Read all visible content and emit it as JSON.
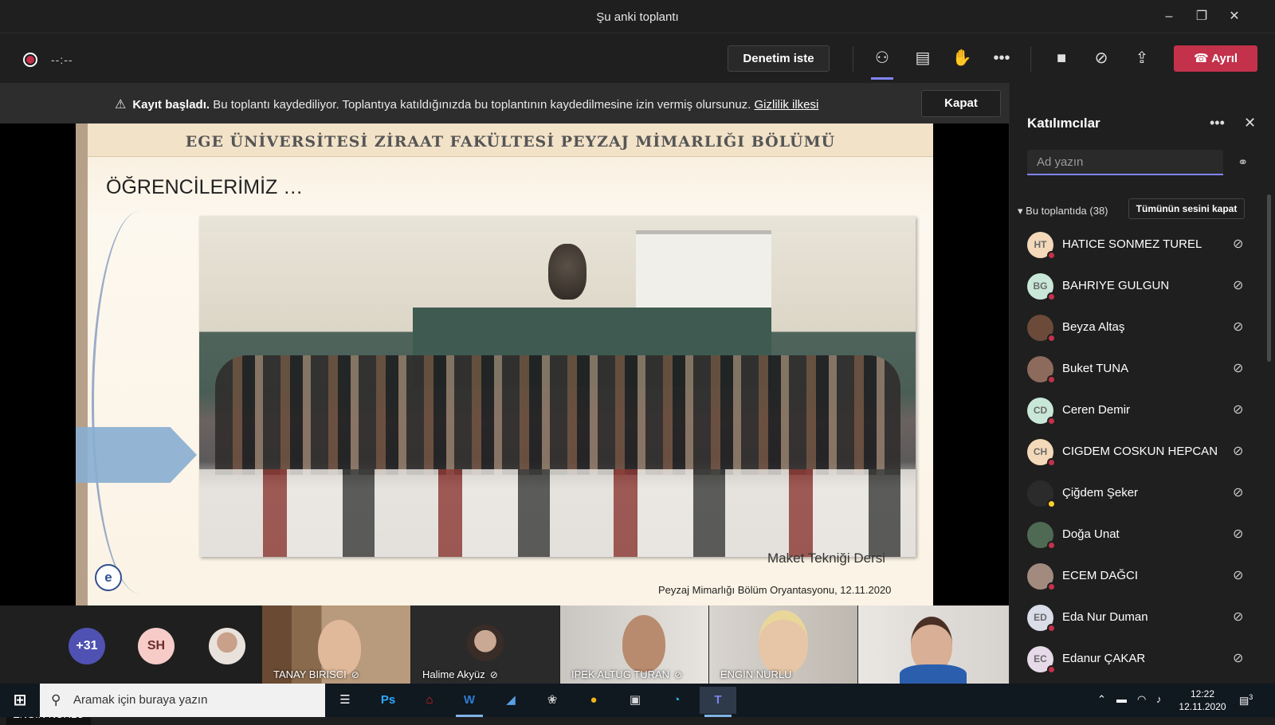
{
  "window": {
    "title": "Şu anki toplantı"
  },
  "toolbar": {
    "timer": "--:--",
    "control_label": "Denetim iste",
    "leave_label": "Ayrıl",
    "icons": [
      "participants-icon",
      "chat-icon",
      "raise-hand-icon",
      "more-options-icon",
      "camera-icon",
      "mic-muted-icon",
      "share-screen-icon"
    ]
  },
  "banner": {
    "bold": "Kayıt başladı.",
    "text": " Bu toplantı kaydediliyor. Toplantıya katıldığınızda bu toplantının kaydedilmesine izin vermiş olursunuz. ",
    "link": "Gizlilik ilkesi",
    "close_label": "Kapat"
  },
  "slide": {
    "header": "EGE ÜNİVERSİTESİ ZİRAAT FAKÜLTESİ PEYZAJ MİMARLIĞI BÖLÜMÜ",
    "subtitle": "ÖĞRENCİLERİMİZ …",
    "caption": "Maket Tekniği Dersi",
    "footer": "Peyzaj Mimarlığı Bölüm Oryantasyonu, 12.11.2020"
  },
  "presenter": {
    "name": "ENGIN NURLU"
  },
  "strip": {
    "more_count": "+31",
    "initials": "SH",
    "tiles": [
      {
        "name": "TANAY BIRISCI"
      },
      {
        "name": "Halime Akyüz"
      },
      {
        "name": "IPEK ALTUG TURAN"
      },
      {
        "name": "ENGIN NURLU"
      }
    ]
  },
  "panel": {
    "title": "Katılımcılar",
    "search_placeholder": "Ad yazın",
    "section": "Bu toplantıda (38)",
    "mute_all": "Tümünün sesini kapat",
    "participants": [
      {
        "initials": "HT",
        "name": "HATICE SONMEZ TUREL",
        "color": "#f3d9b9"
      },
      {
        "initials": "BG",
        "name": "BAHRIYE GULGUN",
        "color": "#c9e7d8"
      },
      {
        "initials": "",
        "name": "Beyza Altaş",
        "color": "#6b4a3a"
      },
      {
        "initials": "",
        "name": "Buket TUNA",
        "color": "#8c6a5c"
      },
      {
        "initials": "CD",
        "name": "Ceren Demir",
        "color": "#c9e7d8"
      },
      {
        "initials": "CH",
        "name": "CIGDEM COSKUN HEPCAN",
        "color": "#f3d9b9"
      },
      {
        "initials": "",
        "name": "Çiğdem Şeker",
        "color": "#2b2b2b"
      },
      {
        "initials": "",
        "name": "Doğa Unat",
        "color": "#4f6a52"
      },
      {
        "initials": "",
        "name": "ECEM DAĞCI",
        "color": "#a28b7e"
      },
      {
        "initials": "ED",
        "name": "Eda Nur Duman",
        "color": "#d9dde8"
      },
      {
        "initials": "EC",
        "name": "Edanur ÇAKAR",
        "color": "#e6d9e8"
      }
    ]
  },
  "taskbar": {
    "search_placeholder": "Aramak için buraya yazın",
    "time": "12:22",
    "date": "12.11.2020",
    "notifications": "3"
  }
}
